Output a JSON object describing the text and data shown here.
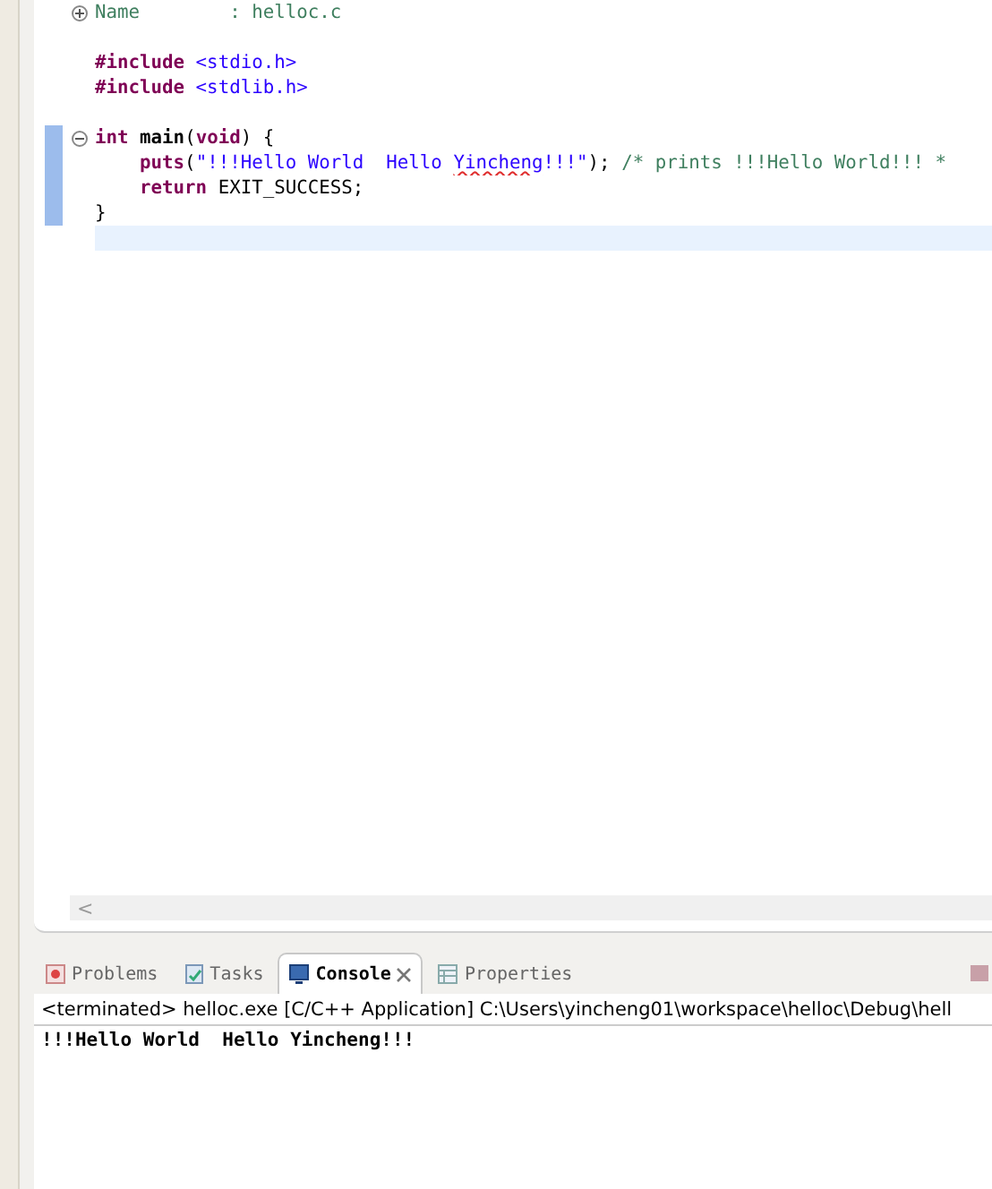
{
  "editor": {
    "lines": [
      {
        "kind": "folded",
        "tokens": [
          {
            "kind": "comment",
            "text": "Name        : helloc.c"
          }
        ]
      },
      {
        "kind": "blank"
      },
      {
        "kind": "code",
        "tokens": [
          {
            "kind": "directive",
            "text": "#include"
          },
          {
            "kind": "header",
            "text": " <stdio.h>"
          }
        ]
      },
      {
        "kind": "code",
        "tokens": [
          {
            "kind": "directive",
            "text": "#include"
          },
          {
            "kind": "header",
            "text": " <stdlib.h>"
          }
        ]
      },
      {
        "kind": "blank"
      },
      {
        "kind": "fold_start",
        "tokens": [
          {
            "kind": "keyword",
            "text": "int"
          },
          {
            "kind": "function",
            "text": " main"
          },
          {
            "kind": "plain",
            "text": "("
          },
          {
            "kind": "keyword",
            "text": "void"
          },
          {
            "kind": "plain",
            "text": ") {"
          }
        ]
      },
      {
        "kind": "code",
        "tokens": [
          {
            "kind": "keyword",
            "text": "    puts"
          },
          {
            "kind": "plain",
            "text": "("
          },
          {
            "kind": "string",
            "text": "\"!!!Hello World  Hello "
          },
          {
            "kind": "misspelled",
            "text": "Yincheng"
          },
          {
            "kind": "string",
            "text": "!!!\""
          },
          {
            "kind": "plain",
            "text": "); "
          },
          {
            "kind": "comment",
            "text": "/* prints !!!Hello World!!! *"
          }
        ]
      },
      {
        "kind": "code",
        "tokens": [
          {
            "kind": "keyword",
            "text": "    return"
          },
          {
            "kind": "plain",
            "text": " EXIT_SUCCESS;"
          }
        ]
      },
      {
        "kind": "fold_end",
        "tokens": [
          {
            "kind": "plain",
            "text": "}"
          }
        ]
      },
      {
        "kind": "current"
      }
    ],
    "scroll_arrow": "<"
  },
  "bottom_panel": {
    "tabs": [
      {
        "label": "Problems",
        "selected": false
      },
      {
        "label": "Tasks",
        "selected": false
      },
      {
        "label": "Console",
        "selected": true
      },
      {
        "label": "Properties",
        "selected": false
      }
    ],
    "console": {
      "header": "<terminated> helloc.exe [C/C++ Application] C:\\Users\\yincheng01\\workspace\\helloc\\Debug\\hell",
      "output": "!!!Hello World  Hello Yincheng!!!"
    }
  }
}
